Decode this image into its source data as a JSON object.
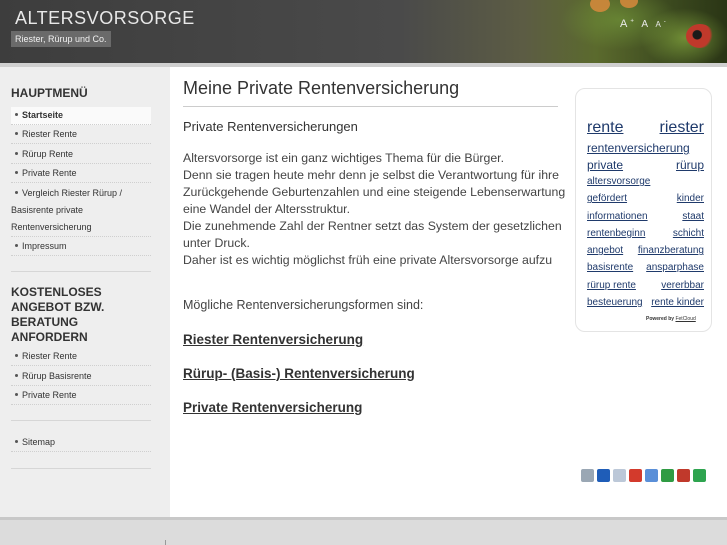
{
  "header": {
    "title": "ALTERSVORSORGE",
    "subtitle": "Riester, Rürup und Co.",
    "font_larger": "A+",
    "font_reset": "A",
    "font_smaller": "A-"
  },
  "sidebar": {
    "menu_heading": "HAUPTMENÜ",
    "menu_items": [
      {
        "label": "Startseite",
        "active": true
      },
      {
        "label": "Riester Rente"
      },
      {
        "label": "Rürup Rente"
      },
      {
        "label": "Private Rente"
      },
      {
        "label_lines": [
          "Vergleich Riester Rürup /",
          "Basisrente private",
          "Rentenversicherung"
        ]
      },
      {
        "label": "Impressum"
      }
    ],
    "offer_heading": "KOSTENLOSES ANGEBOT BZW. BERATUNG ANFORDERN",
    "offer_items": [
      {
        "label": "Riester Rente"
      },
      {
        "label": "Rürup Basisrente"
      },
      {
        "label": "Private Rente"
      }
    ],
    "sitemap_label": "Sitemap"
  },
  "main": {
    "title": "Meine Private Rentenversicherung",
    "subtitle": "Private Rentenversicherungen",
    "paragraph_lines": [
      "Altersvorsorge ist ein ganz wichtiges Thema für die Bürger.",
      "Denn sie tragen heute mehr denn je selbst die Verantwortung für ihre",
      "Zurückgehende Geburtenzahlen und eine steigende Lebenserwartung",
      "eine Wandel der Altersstruktur.",
      "Die zunehmende Zahl der Rentner setzt das System der gesetzlichen",
      "unter Druck.",
      "Daher ist es wichtig möglichst früh eine private Altersvorsorge aufzu"
    ],
    "forms_intro": "Mögliche Rentenversicherungsformen sind:",
    "links": [
      "Riester Rentenversicherung",
      "Rürup- (Basis-) Rentenversicherung",
      "Private Rentenversicherung"
    ]
  },
  "tagcloud": {
    "rows": [
      {
        "size": 16,
        "tags": [
          "rente",
          "riester"
        ]
      },
      {
        "size": 12,
        "tags": [
          "rentenversicherung"
        ]
      },
      {
        "size": 12,
        "tags": [
          "private",
          "rürup"
        ]
      },
      {
        "size": 10,
        "tags": [
          "altersvorsorge"
        ]
      },
      {
        "size": 10,
        "tags": [
          "gefördert",
          "kinder"
        ]
      },
      {
        "size": 10,
        "tags": [
          "informationen",
          "staat"
        ]
      },
      {
        "size": 10,
        "tags": [
          "rentenbeginn",
          "schicht"
        ]
      },
      {
        "size": 10,
        "tags": [
          "angebot",
          "finanzberatung"
        ]
      },
      {
        "size": 10,
        "tags": [
          "basisrente",
          "ansparphase"
        ]
      },
      {
        "size": 10,
        "tags": [
          "rürup rente",
          "vererbbar"
        ]
      },
      {
        "size": 10,
        "tags": [
          "besteuerung",
          "rente kinder"
        ]
      }
    ],
    "powered_label": "Powered by",
    "powered_link": "FetCloud"
  },
  "share": {
    "icons": [
      {
        "name": "digg-icon",
        "color": "#9aa7b4"
      },
      {
        "name": "delicious-icon",
        "color": "#1f5db8"
      },
      {
        "name": "reddit-icon",
        "color": "#bcc8d8"
      },
      {
        "name": "yahoo-icon",
        "color": "#d33a2c"
      },
      {
        "name": "google-icon",
        "color": "#5a8fd8"
      },
      {
        "name": "stumbleupon-icon",
        "color": "#2f9b43"
      },
      {
        "name": "mrwong-icon",
        "color": "#c0392b"
      },
      {
        "name": "linkarena-icon",
        "color": "#2ea44f"
      }
    ]
  },
  "colors": {
    "header_bg": "#444444",
    "sidebar_bg": "#eeeeee",
    "link": "#333333",
    "tag": "#1f3a6b"
  }
}
